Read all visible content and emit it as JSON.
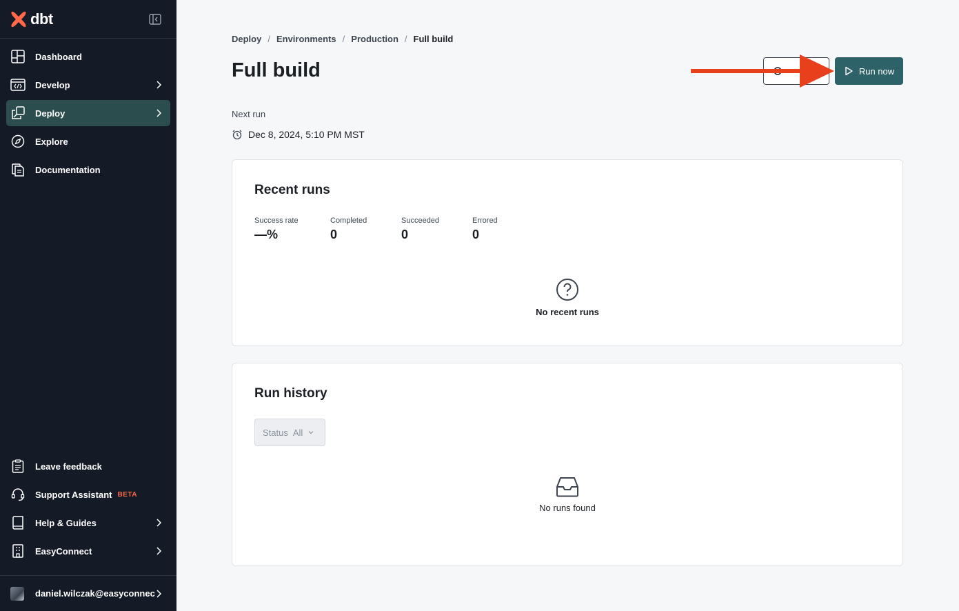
{
  "app": {
    "name": "dbt"
  },
  "sidebar": {
    "items": [
      {
        "label": "Dashboard",
        "icon": "dashboard-icon"
      },
      {
        "label": "Develop",
        "icon": "code-file-icon"
      },
      {
        "label": "Deploy",
        "icon": "deploy-icon",
        "active": true
      },
      {
        "label": "Explore",
        "icon": "compass-icon"
      },
      {
        "label": "Documentation",
        "icon": "documents-icon"
      }
    ],
    "bottom": [
      {
        "label": "Leave feedback",
        "icon": "clipboard-icon"
      },
      {
        "label": "Support Assistant",
        "icon": "headset-icon",
        "badge": "BETA"
      },
      {
        "label": "Help & Guides",
        "icon": "book-icon"
      },
      {
        "label": "EasyConnect",
        "icon": "building-icon"
      }
    ],
    "user": "daniel.wilczak@easyconnec"
  },
  "breadcrumb": [
    "Deploy",
    "Environments",
    "Production",
    "Full build"
  ],
  "page": {
    "title": "Full build",
    "run_now_label": "Run now",
    "next_run_label": "Next run",
    "next_run_value": "Dec 8, 2024, 5:10 PM MST"
  },
  "recent_runs": {
    "title": "Recent runs",
    "stats": [
      {
        "label": "Success rate",
        "value": "—%"
      },
      {
        "label": "Completed",
        "value": "0"
      },
      {
        "label": "Succeeded",
        "value": "0"
      },
      {
        "label": "Errored",
        "value": "0"
      }
    ],
    "empty_text": "No recent runs"
  },
  "run_history": {
    "title": "Run history",
    "filter_label": "Status",
    "filter_value": "All",
    "empty_text": "No runs found"
  },
  "colors": {
    "sidebar_bg": "#141b26",
    "active_bg": "#2b4d4d",
    "primary": "#2d6368",
    "brand": "#ff694a",
    "arrow": "#e8401c"
  }
}
